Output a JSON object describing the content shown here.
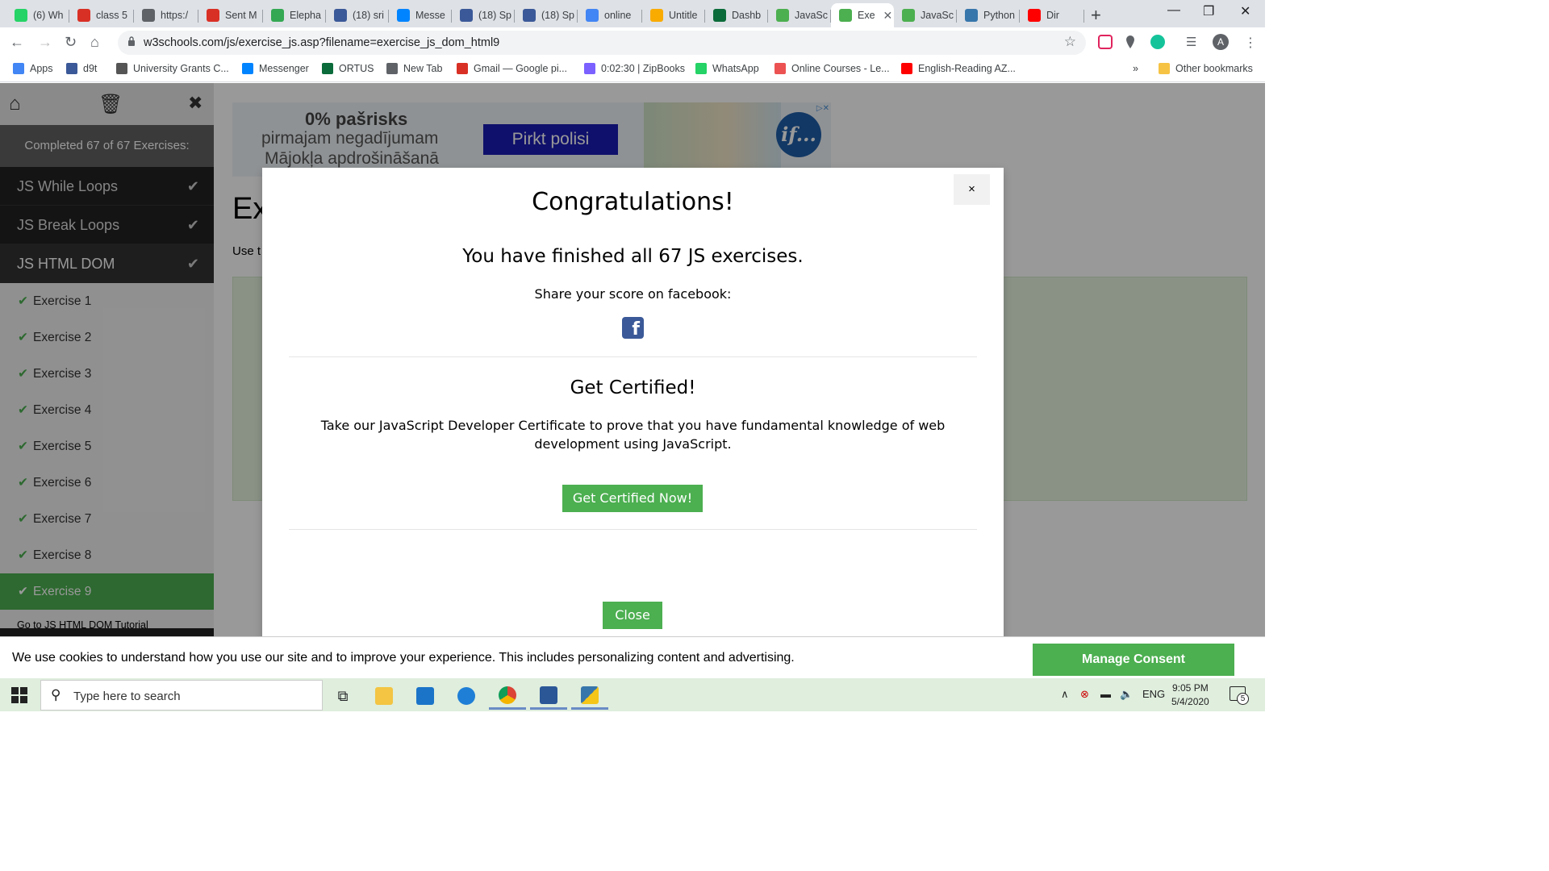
{
  "browser": {
    "tabs": [
      {
        "label": "(6) Wh",
        "icon": "whatsapp-icon",
        "color": "#25d366"
      },
      {
        "label": "class 5",
        "icon": "gmail-icon",
        "color": "#d93025"
      },
      {
        "label": "https:/",
        "icon": "globe-icon",
        "color": "#5f6368"
      },
      {
        "label": "Sent M",
        "icon": "gmail-icon",
        "color": "#d93025"
      },
      {
        "label": "Elepha",
        "icon": "maps-icon",
        "color": "#34a853"
      },
      {
        "label": "(18) sri",
        "icon": "facebook-icon",
        "color": "#3b5998"
      },
      {
        "label": "Messe",
        "icon": "messenger-icon",
        "color": "#0084ff"
      },
      {
        "label": "(18) Sp",
        "icon": "facebook-icon",
        "color": "#3b5998"
      },
      {
        "label": "(18) Sp",
        "icon": "facebook-icon",
        "color": "#3b5998"
      },
      {
        "label": "online",
        "icon": "google-icon",
        "color": "#4285f4"
      },
      {
        "label": "Untitle",
        "icon": "colab-icon",
        "color": "#f9ab00"
      },
      {
        "label": "Dashb",
        "icon": "dashboard-icon",
        "color": "#0b6b3a"
      },
      {
        "label": "JavaSc",
        "icon": "w3schools-icon",
        "color": "#4caf50"
      },
      {
        "label": "Exe",
        "icon": "w3schools-icon",
        "color": "#4caf50"
      },
      {
        "label": "JavaSc",
        "icon": "w3schools-icon",
        "color": "#4caf50"
      },
      {
        "label": "Python",
        "icon": "python-icon",
        "color": "#3776ab"
      },
      {
        "label": "Dir",
        "icon": "youtube-icon",
        "color": "#ff0000"
      }
    ],
    "url": "w3schools.com/js/exercise_js.asp?filename=exercise_js_dom_html9",
    "bookmarks": [
      {
        "label": "Apps",
        "icon": "apps-grid-icon",
        "color": "#4285f4"
      },
      {
        "label": "d9t",
        "icon": "facebook-icon",
        "color": "#3b5998"
      },
      {
        "label": "University Grants C...",
        "icon": "ugc-icon",
        "color": "#555555"
      },
      {
        "label": "Messenger",
        "icon": "messenger-icon",
        "color": "#0084ff"
      },
      {
        "label": "ORTUS",
        "icon": "ortus-icon",
        "color": "#0b6b3a"
      },
      {
        "label": "New Tab",
        "icon": "globe-icon",
        "color": "#5f6368"
      },
      {
        "label": "Gmail — Google pi...",
        "icon": "gmail-icon",
        "color": "#d93025"
      },
      {
        "label": "0:02:30 | ZipBooks",
        "icon": "zipbooks-icon",
        "color": "#7b61ff"
      },
      {
        "label": "WhatsApp",
        "icon": "whatsapp-icon",
        "color": "#25d366"
      },
      {
        "label": "Online Courses - Le...",
        "icon": "udemy-icon",
        "color": "#ec5252"
      },
      {
        "label": "English-Reading AZ...",
        "icon": "youtube-icon",
        "color": "#ff0000"
      }
    ],
    "more_bookmarks": "»",
    "other_bookmarks": "Other bookmarks",
    "profile_initial": "A"
  },
  "sidebar": {
    "completed": "Completed 67 of 67 Exercises:",
    "chapters": [
      {
        "label": "JS While Loops",
        "check": "✔"
      },
      {
        "label": "JS Break Loops",
        "check": "✔"
      },
      {
        "label": "JS HTML DOM",
        "check": "✔"
      }
    ],
    "exercises": [
      {
        "label": "Exercise 1"
      },
      {
        "label": "Exercise 2"
      },
      {
        "label": "Exercise 3"
      },
      {
        "label": "Exercise 4"
      },
      {
        "label": "Exercise 5"
      },
      {
        "label": "Exercise 6"
      },
      {
        "label": "Exercise 7"
      },
      {
        "label": "Exercise 8"
      },
      {
        "label": "Exercise 9"
      }
    ],
    "tutorial_link": "Go to JS HTML DOM Tutorial"
  },
  "ad": {
    "line1": "0% pašrisks",
    "line2": "pirmajam negadījumam",
    "line3": "Mājokļa apdrošināšanā",
    "button": "Pirkt polisi",
    "logo": "if..."
  },
  "exercise": {
    "heading": "Ex",
    "text": "Use t"
  },
  "modal": {
    "close_x": "×",
    "title": "Congratulations!",
    "finished": "You have finished all 67 JS exercises.",
    "share": "Share your score on facebook:",
    "fb_glyph": "f",
    "cert_title": "Get Certified!",
    "cert_text": "Take our JavaScript Developer Certificate to prove that you have fundamental knowledge of web development using JavaScript.",
    "cert_button": "Get Certified Now!",
    "close_button": "Close"
  },
  "cookie": {
    "text": "We use cookies to understand how you use our site and to improve your experience. This includes personalizing content and advertising.",
    "button": "Manage Consent"
  },
  "taskbar": {
    "search_placeholder": "Type here to search",
    "language": "ENG",
    "time": "9:05 PM",
    "date": "5/4/2020",
    "notification_count": "5"
  },
  "colors": {
    "accent_green": "#4caf50",
    "sidebar_dark": "#222222",
    "facebook_blue": "#3b5998"
  }
}
